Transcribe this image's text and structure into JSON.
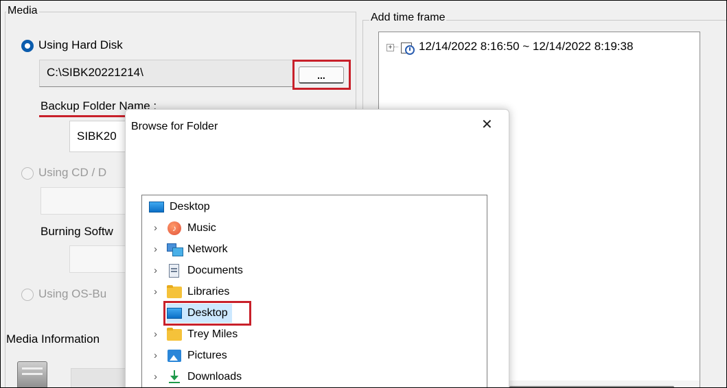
{
  "media": {
    "group_title": "Media",
    "hard_disk_label": "Using Hard Disk",
    "hard_disk_path": "C:\\SIBK20221214\\",
    "browse_button_label": "...",
    "backup_folder_label": "Backup Folder Name :",
    "backup_folder_value": "SIBK20",
    "cd_label": "Using CD / D",
    "burning_label": "Burning Softw",
    "os_label": "Using OS-Bu",
    "info_label": "Media Information"
  },
  "timeframe": {
    "group_title": "Add time frame",
    "entry": "12/14/2022 8:16:50 ~ 12/14/2022 8:19:38"
  },
  "dialog": {
    "title": "Browse for Folder",
    "close_glyph": "✕",
    "tree": [
      {
        "label": "Desktop",
        "icon": "desktop-icon"
      },
      {
        "label": "Music",
        "icon": "music-icon"
      },
      {
        "label": "Network",
        "icon": "network-icon"
      },
      {
        "label": "Documents",
        "icon": "documents-icon"
      },
      {
        "label": "Libraries",
        "icon": "folder-icon"
      },
      {
        "label": "Desktop",
        "icon": "desktop-icon"
      },
      {
        "label": "Trey Miles",
        "icon": "folder-icon"
      },
      {
        "label": "Pictures",
        "icon": "pictures-icon"
      },
      {
        "label": "Downloads",
        "icon": "downloads-icon"
      }
    ]
  },
  "colors": {
    "highlight": "#c8202a",
    "radio_selected": "#0b5cad",
    "window_bg": "#f0f0f0"
  }
}
